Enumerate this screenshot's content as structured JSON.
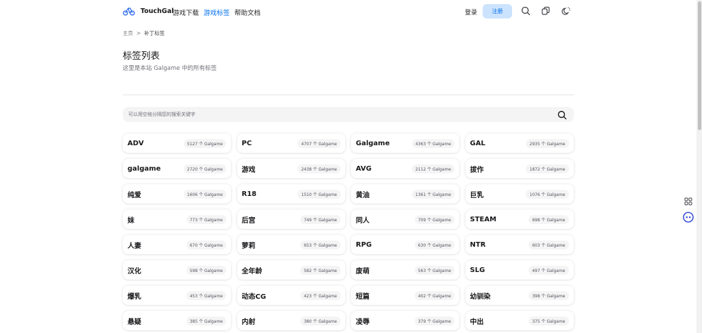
{
  "navbar": {
    "brand": "TouchGal",
    "links": [
      {
        "label": "游戏下载",
        "active": false
      },
      {
        "label": "游戏标签",
        "active": true
      },
      {
        "label": "帮助文档",
        "active": false
      }
    ],
    "login_label": "登录",
    "register_label": "注册",
    "icons": [
      "search-icon",
      "bookmark-icon",
      "theme-toggle-icon"
    ]
  },
  "breadcrumb": {
    "home": "主页",
    "separator": ">",
    "current": "补丁标签"
  },
  "page": {
    "title": "标签列表",
    "subtitle": "这里是本站 Galgame 中的所有标签"
  },
  "search": {
    "placeholder": "可以用空格分隔您的搜索关键字",
    "value": ""
  },
  "tags": [
    {
      "name": "ADV",
      "count": "5127 个 Galgame"
    },
    {
      "name": "PC",
      "count": "4707 个 Galgame"
    },
    {
      "name": "Galgame",
      "count": "4363 个 Galgame"
    },
    {
      "name": "GAL",
      "count": "2935 个 Galgame"
    },
    {
      "name": "galgame",
      "count": "2720 个 Galgame"
    },
    {
      "name": "游戏",
      "count": "2438 个 Galgame"
    },
    {
      "name": "AVG",
      "count": "2112 个 Galgame"
    },
    {
      "name": "拔作",
      "count": "1872 个 Galgame"
    },
    {
      "name": "纯爱",
      "count": "1606 个 Galgame"
    },
    {
      "name": "R18",
      "count": "1510 个 Galgame"
    },
    {
      "name": "黄油",
      "count": "1361 个 Galgame"
    },
    {
      "name": "巨乳",
      "count": "1076 个 Galgame"
    },
    {
      "name": "妹",
      "count": "773 个 Galgame"
    },
    {
      "name": "后宫",
      "count": "749 个 Galgame"
    },
    {
      "name": "同人",
      "count": "709 个 Galgame"
    },
    {
      "name": "STEAM",
      "count": "698 个 Galgame"
    },
    {
      "name": "人妻",
      "count": "670 个 Galgame"
    },
    {
      "name": "萝莉",
      "count": "653 个 Galgame"
    },
    {
      "name": "RPG",
      "count": "630 个 Galgame"
    },
    {
      "name": "NTR",
      "count": "603 个 Galgame"
    },
    {
      "name": "汉化",
      "count": "598 个 Galgame"
    },
    {
      "name": "全年龄",
      "count": "582 个 Galgame"
    },
    {
      "name": "废萌",
      "count": "563 个 Galgame"
    },
    {
      "name": "SLG",
      "count": "497 个 Galgame"
    },
    {
      "name": "爆乳",
      "count": "453 个 Galgame"
    },
    {
      "name": "动态CG",
      "count": "423 个 Galgame"
    },
    {
      "name": "短篇",
      "count": "402 个 Galgame"
    },
    {
      "name": "幼驯染",
      "count": "398 个 Galgame"
    },
    {
      "name": "悬疑",
      "count": "385 个 Galgame"
    },
    {
      "name": "内射",
      "count": "380 个 Galgame"
    },
    {
      "name": "凌辱",
      "count": "379 个 Galgame"
    },
    {
      "name": "中出",
      "count": "375 个 Galgame"
    }
  ],
  "colors": {
    "accent": "#006fee",
    "register_bg": "#cce3fd",
    "search_bg": "#f4f4f5",
    "badge_bg": "#f4f4f5"
  },
  "floating_buttons": [
    "grid-apps-icon",
    "chat-robot-icon"
  ]
}
